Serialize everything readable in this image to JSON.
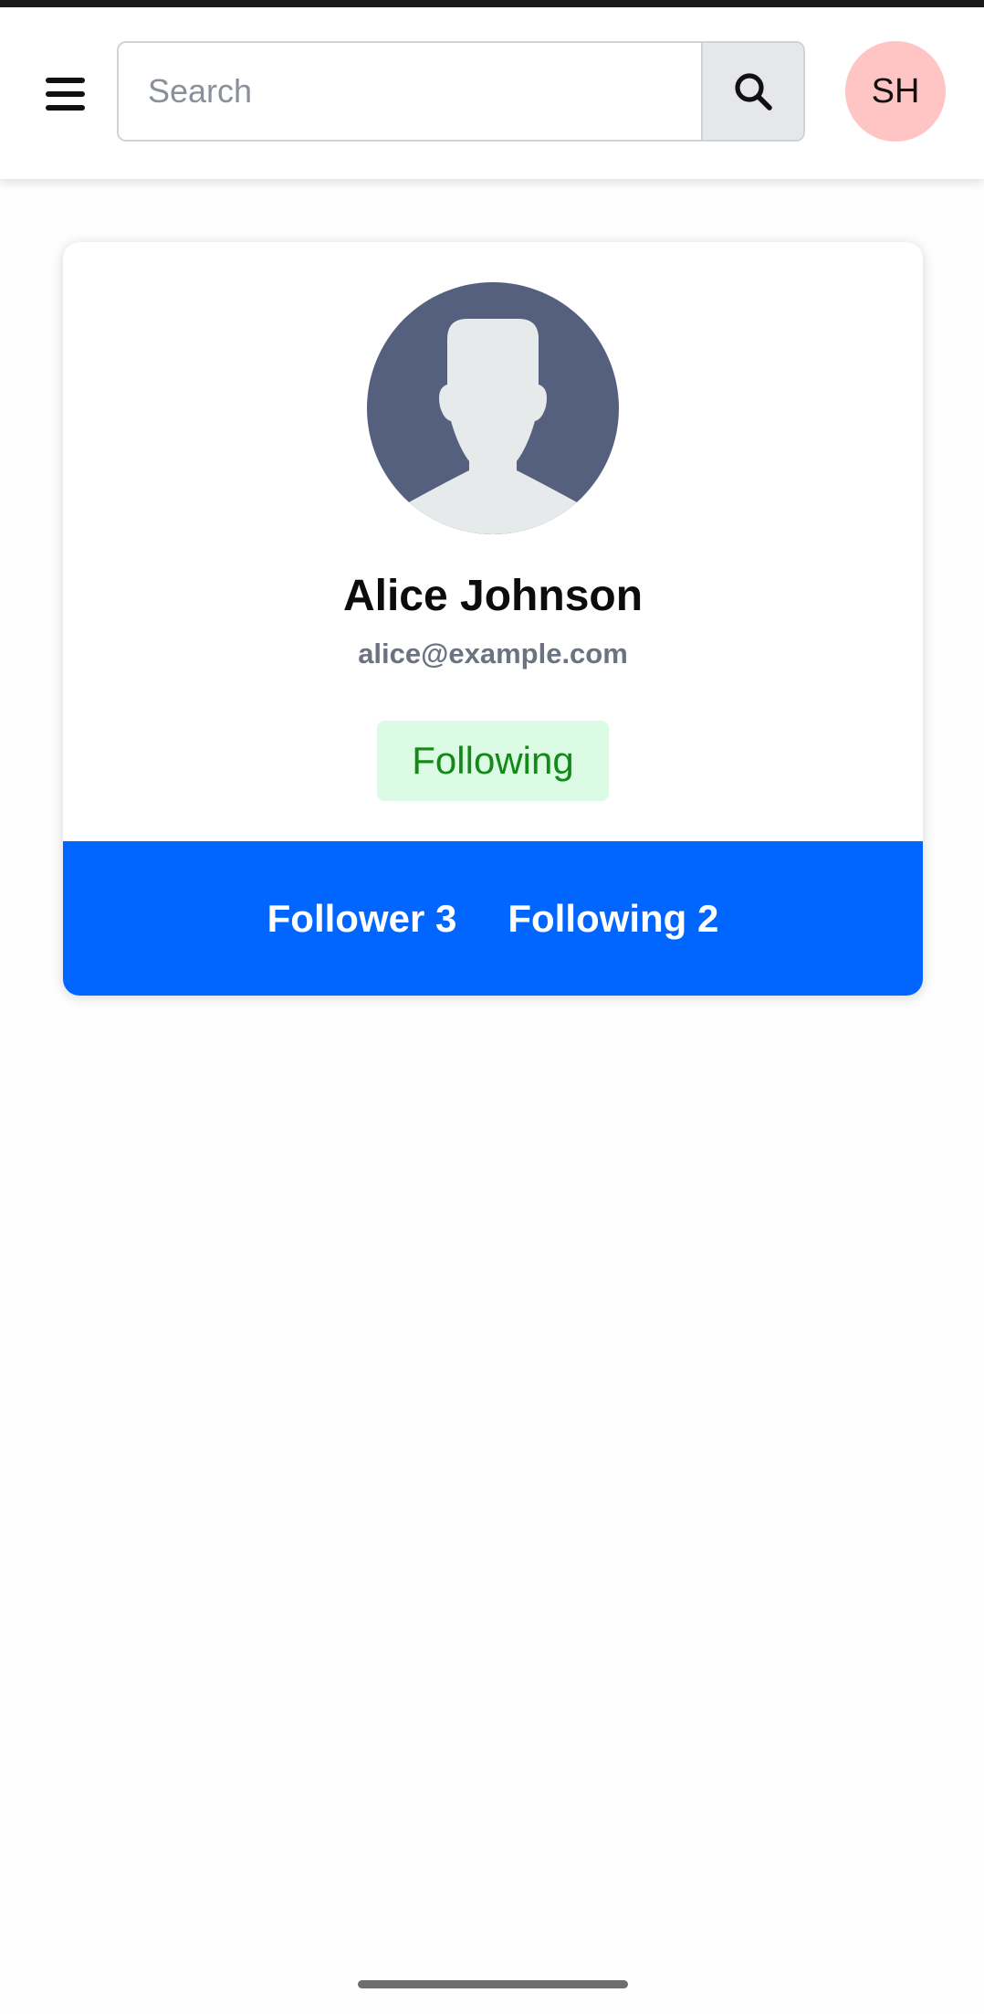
{
  "header": {
    "menu_icon": "hamburger-menu-icon",
    "search": {
      "placeholder": "Search",
      "value": ""
    },
    "search_icon": "search-icon",
    "user_initials": "SH",
    "user_avatar_color": "#ffc5c5"
  },
  "profile": {
    "avatar_icon": "user-silhouette-icon",
    "name": "Alice Johnson",
    "email": "alice@example.com",
    "status": "Following",
    "status_bg": "#dcfbe5",
    "status_color": "#138a17",
    "follower_label": "Follower 3",
    "following_label": "Following 2",
    "stats_bar_color": "#0066ff"
  }
}
